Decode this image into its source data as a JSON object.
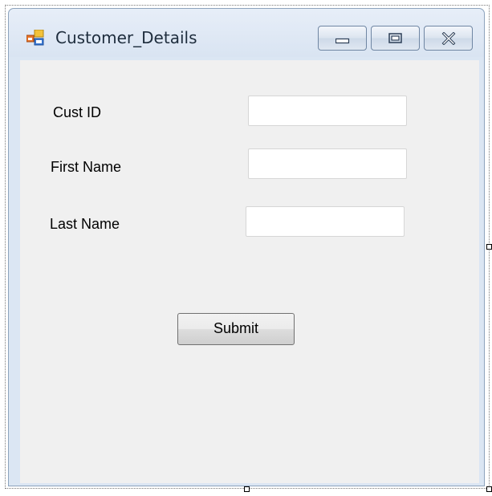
{
  "window": {
    "title": "Customer_Details",
    "icon": "windows-form-icon"
  },
  "caption_buttons": {
    "minimize_icon": "minimize-icon",
    "maximize_icon": "maximize-icon",
    "close_icon": "close-icon"
  },
  "form": {
    "fields": [
      {
        "label": "Cust ID",
        "value": ""
      },
      {
        "label": "First Name",
        "value": ""
      },
      {
        "label": "Last Name",
        "value": ""
      }
    ],
    "submit_label": "Submit"
  },
  "colors": {
    "client_background": "#f0f0f0",
    "frame_background": "#dbe6f3",
    "close_red": "#c45a4a"
  }
}
